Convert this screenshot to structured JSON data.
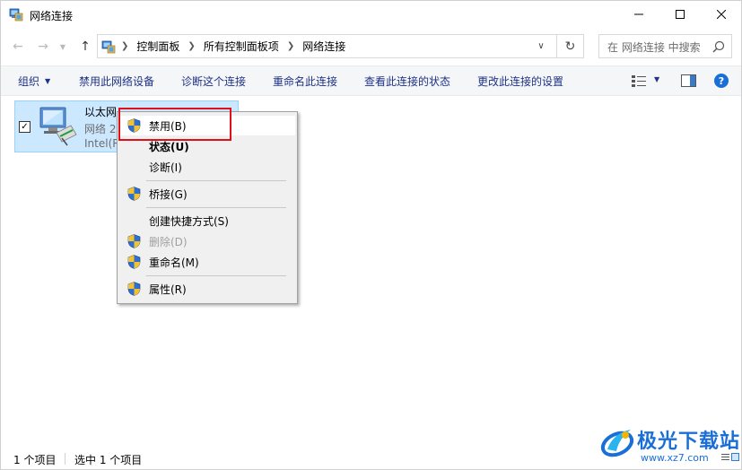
{
  "window": {
    "title": "网络连接",
    "icon": "network-connections-icon",
    "controls": [
      "minimize-icon",
      "maximize-icon",
      "close-icon"
    ]
  },
  "navigation": {
    "back_icon": "back-arrow-icon",
    "forward_icon": "forward-arrow-icon",
    "up_icon": "up-arrow-icon",
    "breadcrumb": [
      "控制面板",
      "所有控制面板项",
      "网络连接"
    ],
    "search_placeholder": "在 网络连接 中搜索",
    "refresh_icon": "refresh-icon"
  },
  "commandbar": {
    "organize": "组织",
    "disable_device": "禁用此网络设备",
    "diagnose": "诊断这个连接",
    "rename": "重命名此连接",
    "view_status": "查看此连接的状态",
    "change_settings": "更改此连接的设置"
  },
  "connection": {
    "name": "以太网",
    "status": "网络 2",
    "device": "Intel(R",
    "checked": true
  },
  "context_menu": {
    "items": [
      {
        "label": "禁用(B)",
        "shield": true,
        "style": "hover"
      },
      {
        "label": "状态(U)",
        "shield": false,
        "style": "bold"
      },
      {
        "label": "诊断(I)",
        "shield": false,
        "style": "normal"
      },
      {
        "label": "桥接(G)",
        "shield": true,
        "style": "normal"
      },
      {
        "label": "创建快捷方式(S)",
        "shield": false,
        "style": "normal"
      },
      {
        "label": "删除(D)",
        "shield": true,
        "style": "disabled"
      },
      {
        "label": "重命名(M)",
        "shield": true,
        "style": "normal"
      },
      {
        "label": "属性(R)",
        "shield": true,
        "style": "normal"
      }
    ],
    "highlight_color": "#e0101a"
  },
  "statusbar": {
    "item_count": "1 个项目",
    "selected_count": "选中 1 个项目"
  },
  "watermark": {
    "name": "极光下载站",
    "url": "www.xz7.com"
  },
  "colors": {
    "accent": "#1a6fd6",
    "selection_bg": "#cce8ff",
    "command_text": "#1e3287"
  }
}
